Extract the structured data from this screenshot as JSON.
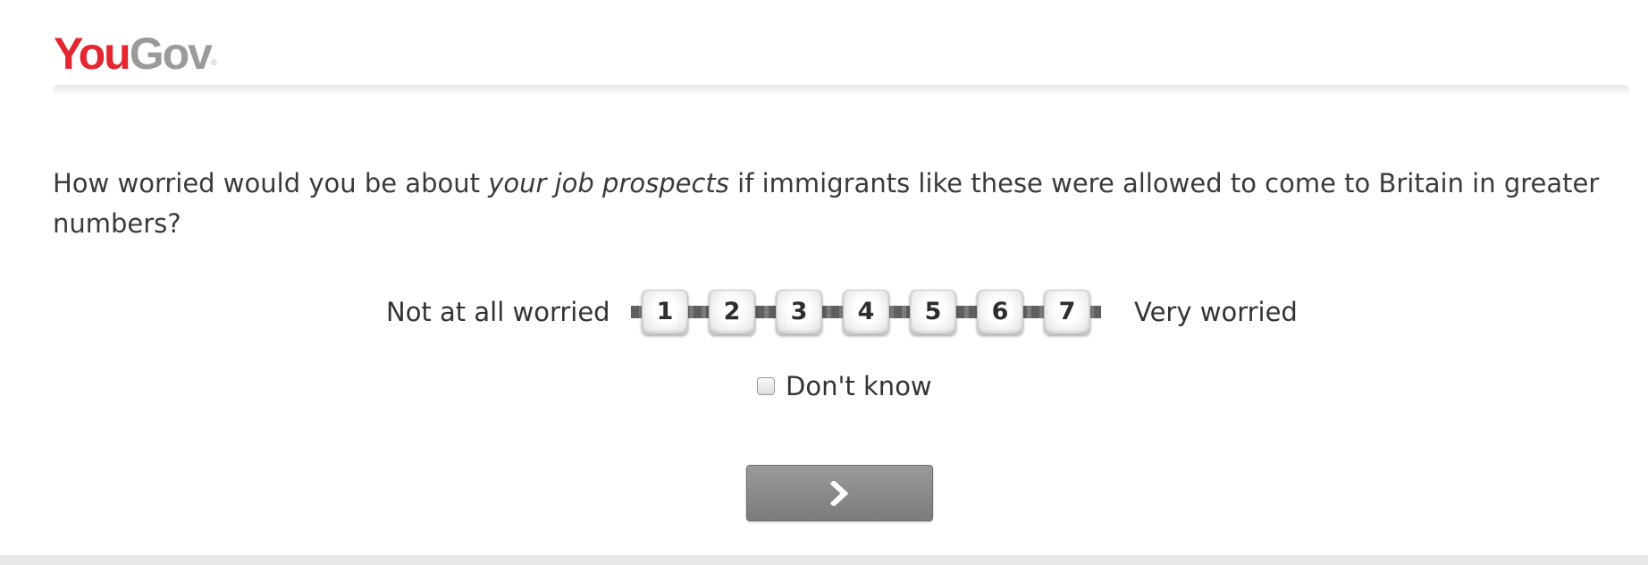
{
  "header": {
    "logo_you": "You",
    "logo_gov": "Gov",
    "logo_reg": "®",
    "brand_red": "#e3262f",
    "brand_grey": "#9a9a9a"
  },
  "question": {
    "prefix": "How worried would you be about ",
    "emphasis": "your job prospects",
    "suffix": " if immigrants like these were allowed to come to Britain in greater numbers?"
  },
  "scale": {
    "left_label": "Not at all worried",
    "right_label": "Very worried",
    "options": [
      "1",
      "2",
      "3",
      "4",
      "5",
      "6",
      "7"
    ],
    "selected": null
  },
  "dont_know": {
    "label": "Don't know",
    "checked": false
  },
  "next_button": {
    "icon": "chevron-right-icon"
  }
}
